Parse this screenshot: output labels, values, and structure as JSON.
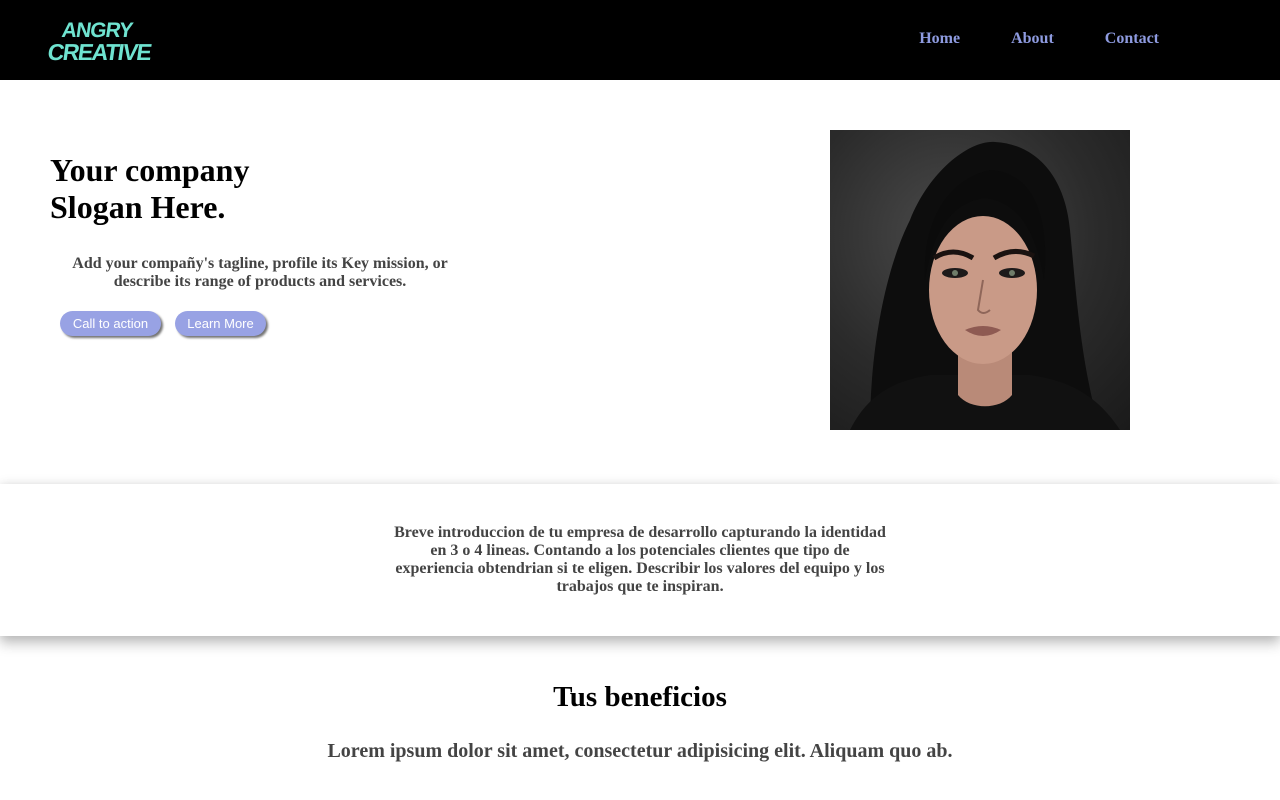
{
  "brand": {
    "logo_line1": "ANGRY",
    "logo_line2": "CREATIVE",
    "logo_color": "#6fe3d0"
  },
  "nav": {
    "home": "Home",
    "about": "About",
    "contact": "Contact",
    "link_color": "#8e9be0"
  },
  "hero": {
    "title_line1": "Your company",
    "title_line2": "Slogan Here.",
    "tagline": "Add your compañy's tagline, profile its Key mission, or describe its range of products and services.",
    "cta_label": "Call to action",
    "learn_more_label": "Learn More",
    "button_color": "#98a2e4",
    "image": "portrait-photo"
  },
  "intro": {
    "text": "Breve introduccion de tu empresa de desarrollo capturando la identidad en 3 o 4 lineas. Contando a los potenciales clientes que tipo de experiencia obtendrian si te eligen. Describir los valores del equipo y los trabajos que te inspiran."
  },
  "benefits": {
    "title": "Tus beneficios",
    "text": "Lorem ipsum dolor sit amet, consectetur adipisicing elit. Aliquam quo ab."
  }
}
